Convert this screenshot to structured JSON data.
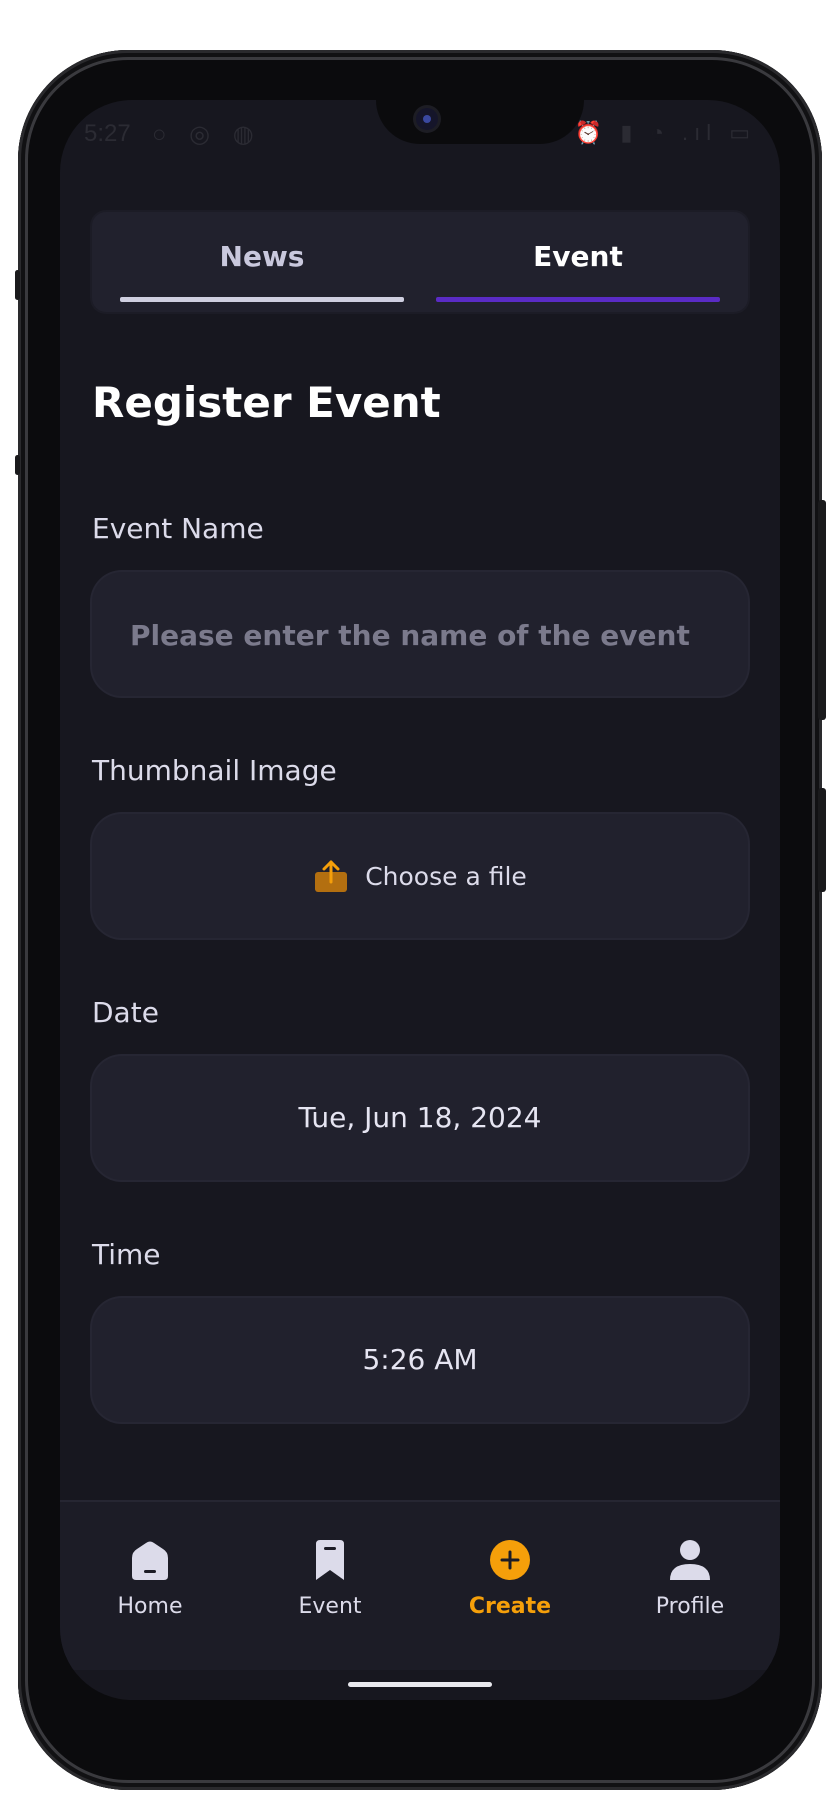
{
  "status_bar": {
    "time": "5:27",
    "left_icons": "○ ◎ ◍",
    "right_icons": "⏰ ▮ ◔ .ıl ▭"
  },
  "tabs": [
    {
      "label": "News",
      "active": false
    },
    {
      "label": "Event",
      "active": true
    }
  ],
  "page": {
    "title": "Register Event"
  },
  "form": {
    "event_name": {
      "label": "Event Name",
      "placeholder": "Please enter the name of the event",
      "value": ""
    },
    "thumbnail": {
      "label": "Thumbnail Image",
      "button_label": "Choose a file",
      "icon": "upload-icon"
    },
    "date": {
      "label": "Date",
      "value": "Tue, Jun 18, 2024"
    },
    "time": {
      "label": "Time",
      "value": "5:26 AM"
    }
  },
  "bottom_nav": {
    "items": [
      {
        "label": "Home",
        "icon": "home-icon",
        "active": false
      },
      {
        "label": "Event",
        "icon": "bookmark-icon",
        "active": false
      },
      {
        "label": "Create",
        "icon": "add-circle-icon",
        "active": true
      },
      {
        "label": "Profile",
        "icon": "person-icon",
        "active": false
      }
    ]
  },
  "colors": {
    "background": "#17171f",
    "surface": "#21212d",
    "accent_purple": "#5a2bc5",
    "accent_orange": "#f59f0a",
    "text": "#dcdbea"
  }
}
